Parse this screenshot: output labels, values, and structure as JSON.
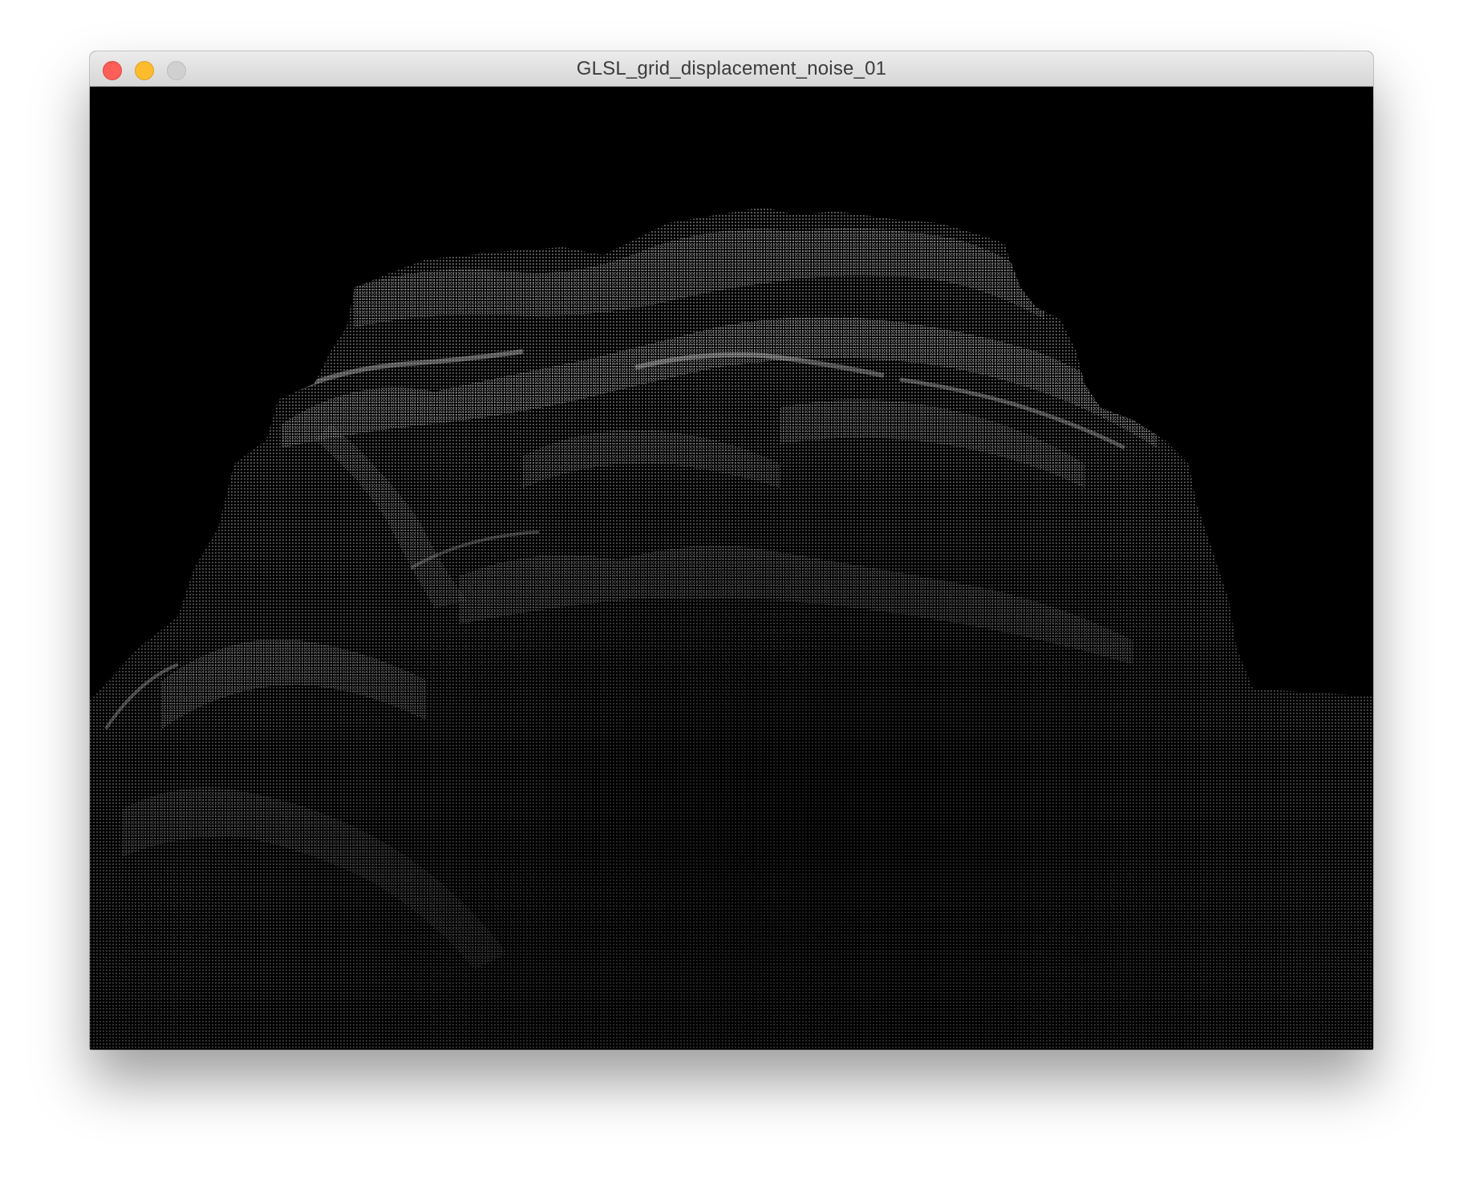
{
  "window": {
    "title": "GLSL_grid_displacement_noise_01"
  },
  "titlebar_buttons": [
    {
      "name": "close",
      "color": "#fc5f57"
    },
    {
      "name": "minimize",
      "color": "#fdbc2e"
    },
    {
      "name": "zoom",
      "color": "#d0d0d0"
    }
  ],
  "canvas": {
    "background": "#000000",
    "content": "point-grid-terrain",
    "point_color": "#ffffff"
  }
}
